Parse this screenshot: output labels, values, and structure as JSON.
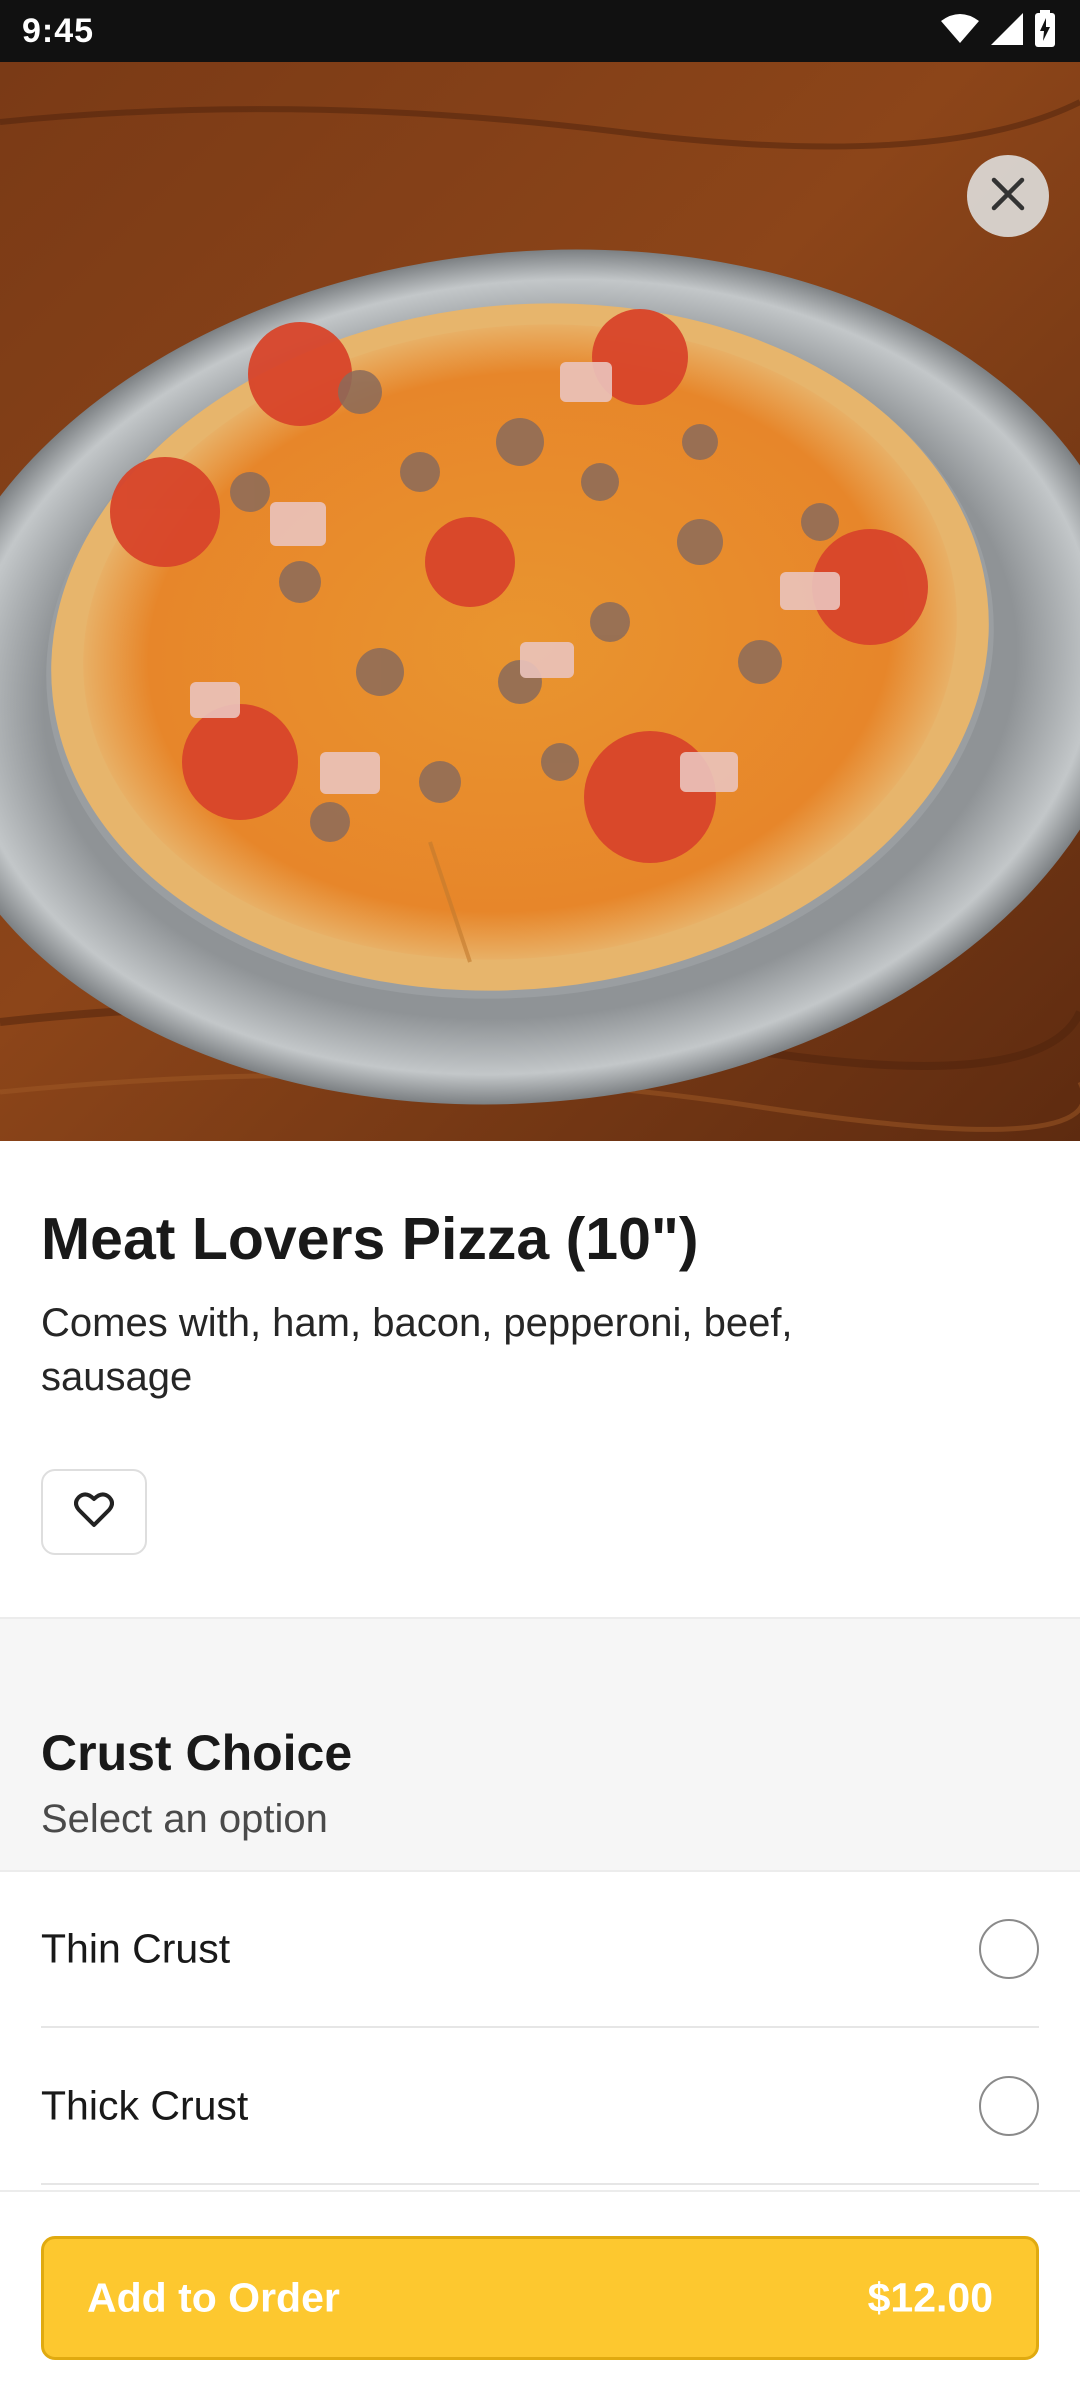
{
  "status_bar": {
    "time": "9:45",
    "icons": [
      "wifi-icon",
      "signal-icon",
      "battery-charging-icon"
    ]
  },
  "hero": {
    "image": "pizza-photo",
    "close_icon": "close-icon"
  },
  "item": {
    "title": "Meat Lovers Pizza (10\")",
    "description": "Comes with, ham, bacon, pepperoni, beef, sausage",
    "favorite_icon": "heart-outline-icon"
  },
  "options_section": {
    "title": "Crust Choice",
    "subtitle": "Select an option",
    "options": [
      {
        "label": "Thin Crust",
        "selected": false
      },
      {
        "label": "Thick Crust",
        "selected": false
      }
    ]
  },
  "footer": {
    "button_label": "Add to Order",
    "price": "$12.00"
  },
  "colors": {
    "accent": "#fdc82f",
    "accent_border": "#e0aa10",
    "status_bar": "#111111",
    "text_primary": "#191919",
    "text_secondary": "#4a4a4a"
  }
}
